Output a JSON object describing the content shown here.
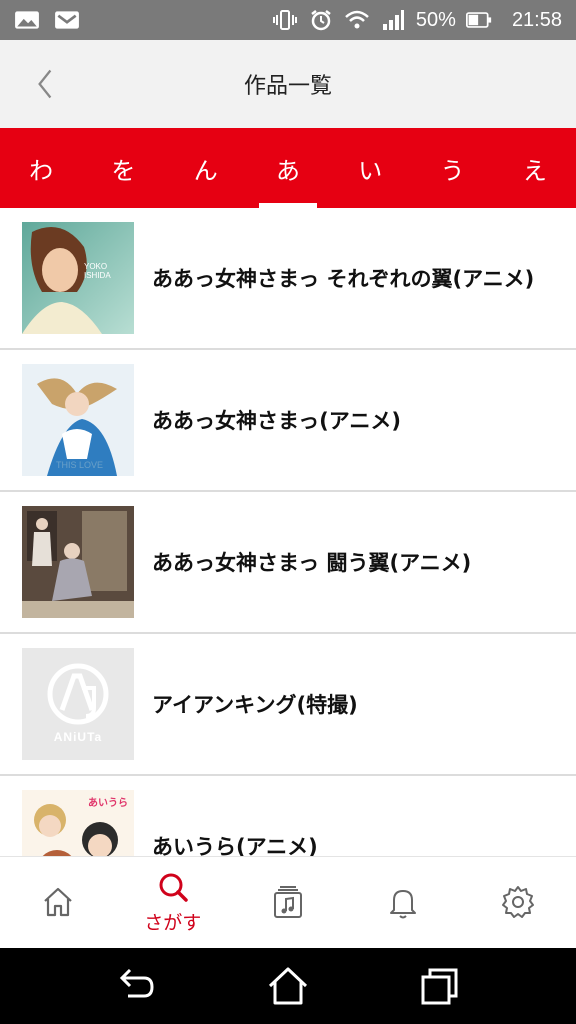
{
  "status_bar": {
    "battery": "50%",
    "time": "21:58",
    "icons": [
      "gallery-icon",
      "mail-icon",
      "vibrate-icon",
      "alarm-icon",
      "wifi-icon",
      "signal-icon",
      "battery-icon"
    ]
  },
  "header": {
    "title": "作品一覧",
    "back_icon": "chevron-left-icon"
  },
  "kana_tabs": [
    {
      "label": "わ",
      "active": false
    },
    {
      "label": "を",
      "active": false
    },
    {
      "label": "ん",
      "active": false
    },
    {
      "label": "あ",
      "active": true
    },
    {
      "label": "い",
      "active": false
    },
    {
      "label": "う",
      "active": false
    },
    {
      "label": "え",
      "active": false
    }
  ],
  "works": [
    {
      "title": "ああっ女神さまっ それぞれの翼(アニメ)",
      "thumb_text": "YOKO ISHIDA"
    },
    {
      "title": "ああっ女神さまっ(アニメ)",
      "thumb_text": "THIS LOVE"
    },
    {
      "title": "ああっ女神さまっ 闘う翼(アニメ)",
      "thumb_text": ""
    },
    {
      "title": "アイアンキング(特撮)",
      "thumb_text": "ANiUTa"
    },
    {
      "title": "あいうら(アニメ)",
      "thumb_text": "あいうら"
    }
  ],
  "bottom_nav": {
    "items": [
      {
        "icon": "home-icon",
        "label": ""
      },
      {
        "icon": "search-icon",
        "label": "さがす"
      },
      {
        "icon": "music-library-icon",
        "label": ""
      },
      {
        "icon": "bell-icon",
        "label": ""
      },
      {
        "icon": "gear-icon",
        "label": ""
      }
    ]
  },
  "colors": {
    "accent": "#e60012",
    "nav_active": "#d0021b"
  }
}
